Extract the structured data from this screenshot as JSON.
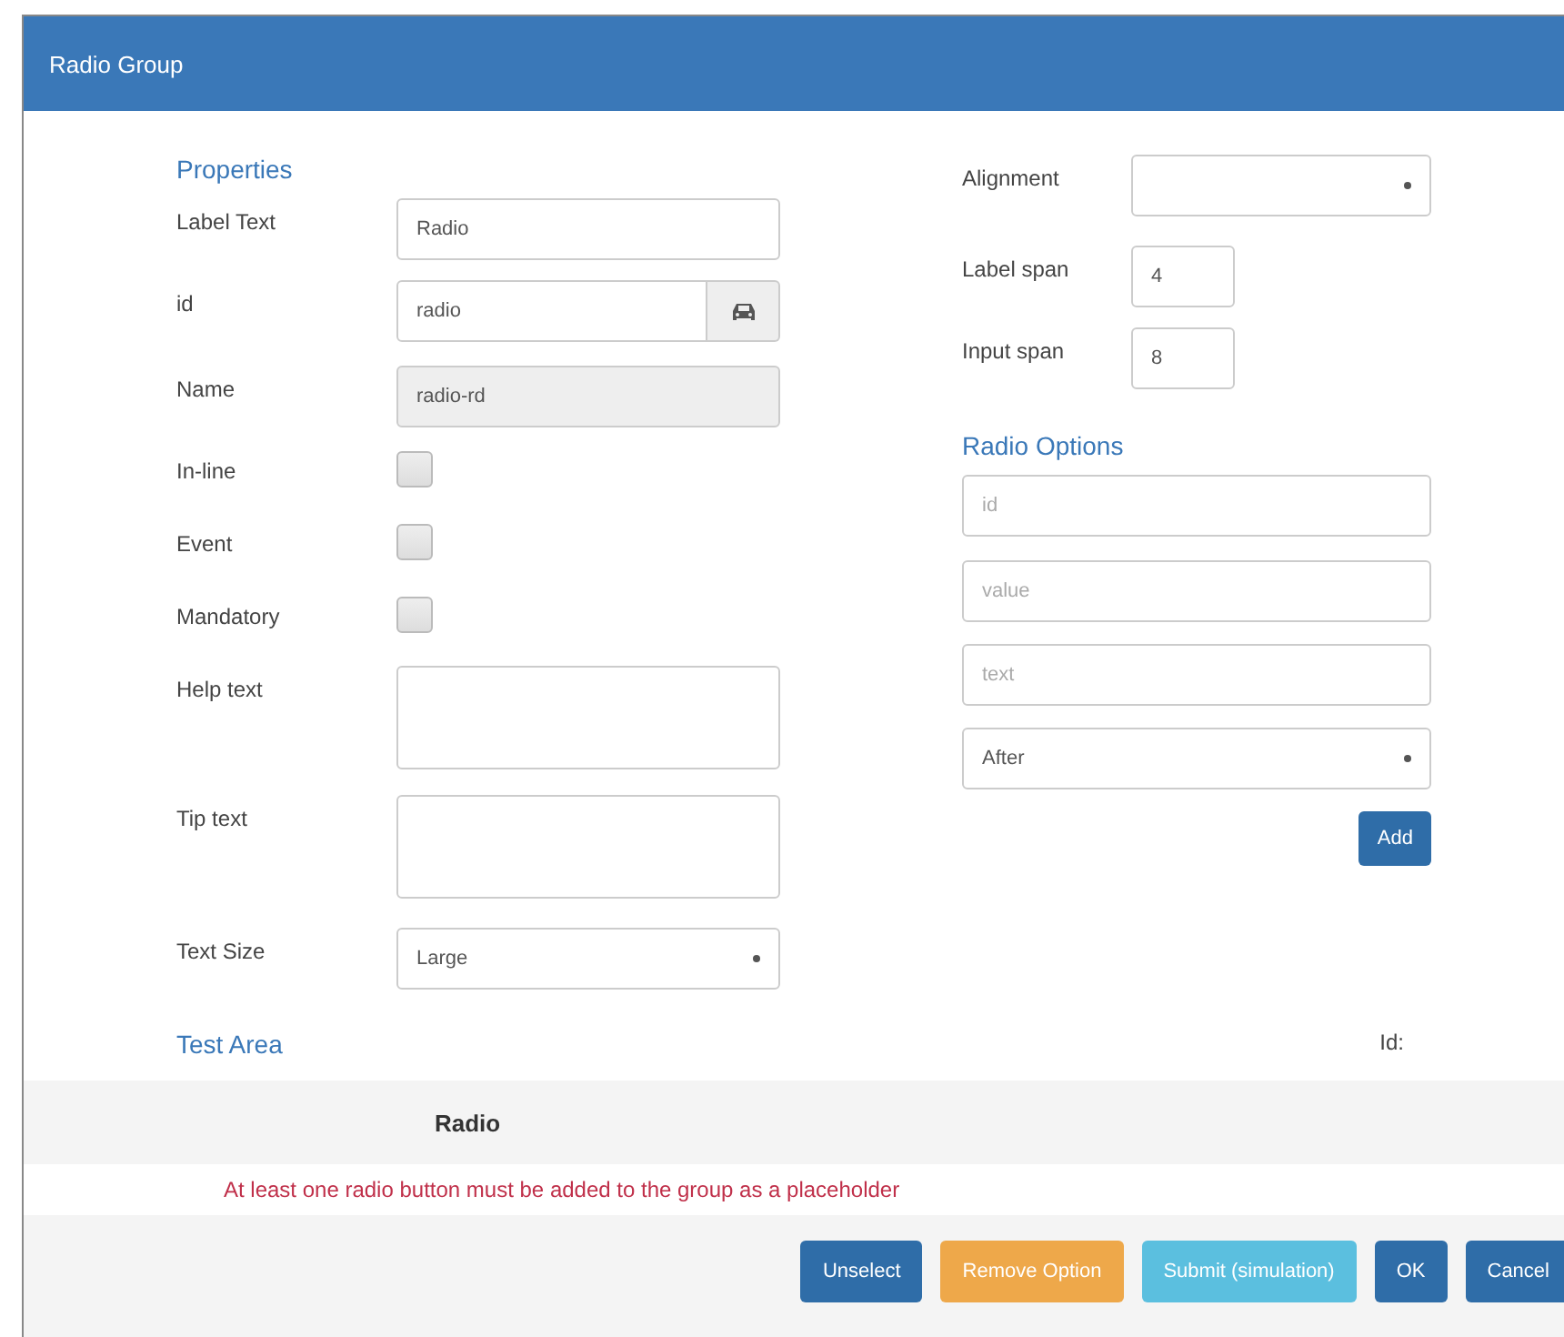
{
  "window": {
    "title": "Radio Group"
  },
  "properties": {
    "heading": "Properties",
    "fields": [
      {
        "kind": "text",
        "label": "Label Text",
        "value": "Radio"
      },
      {
        "kind": "addon",
        "label": "id",
        "value": "radio"
      },
      {
        "kind": "readonly",
        "label": "Name",
        "value": "radio-rd"
      },
      {
        "kind": "checkbox",
        "label": "In-line",
        "checked": false
      },
      {
        "kind": "checkbox",
        "label": "Event",
        "checked": false
      },
      {
        "kind": "checkbox",
        "label": "Mandatory",
        "checked": false
      },
      {
        "kind": "textarea",
        "label": "Help text"
      },
      {
        "kind": "textarea",
        "label": "Tip text"
      },
      {
        "kind": "select",
        "label": "Text Size",
        "value": "Large"
      }
    ]
  },
  "layout": {
    "fields": [
      {
        "kind": "select",
        "label": "Alignment"
      },
      {
        "kind": "small",
        "label": "Label span",
        "value": "4"
      },
      {
        "kind": "small",
        "label": "Input span",
        "value": "8"
      }
    ]
  },
  "radio_options": {
    "heading": "Radio Options",
    "fields": [
      {
        "kind": "text",
        "placeholder": "id"
      },
      {
        "kind": "text",
        "placeholder": "value"
      },
      {
        "kind": "text",
        "placeholder": "text"
      },
      {
        "kind": "select",
        "value": "After"
      }
    ],
    "add_button": "Add"
  },
  "test_area": {
    "heading": "Test Area",
    "id_label": "Id:",
    "label": "Radio",
    "message": "At least one radio button must be added to the group as a placeholder"
  },
  "buttons": [
    {
      "label": "Unselect",
      "kind": "primary"
    },
    {
      "label": "Remove Option",
      "kind": "warning"
    },
    {
      "label": "Submit (simulation)",
      "kind": "info"
    },
    {
      "label": "OK",
      "kind": "primary"
    },
    {
      "label": "Cancel",
      "kind": "primary"
    }
  ]
}
